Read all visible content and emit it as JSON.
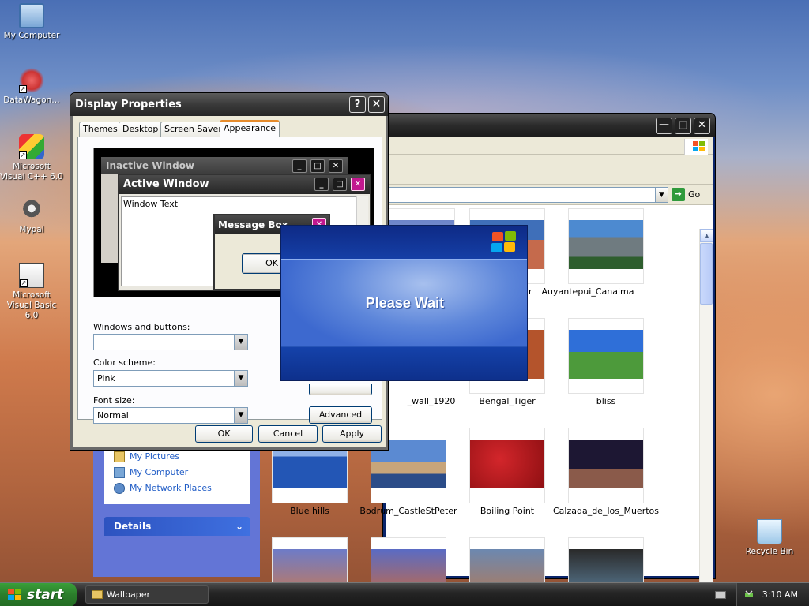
{
  "desktop": {
    "icons": [
      {
        "label": "My Computer",
        "icon": "my-computer-icon"
      },
      {
        "label": "DataWagon…",
        "icon": "datawagon-icon"
      },
      {
        "label": "Microsoft Visual C++ 6.0",
        "icon": "visual-cpp-icon"
      },
      {
        "label": "Mypal",
        "icon": "mypal-icon"
      },
      {
        "label": "Microsoft Visual Basic 6.0",
        "icon": "visual-basic-icon"
      },
      {
        "label": "Recycle Bin",
        "icon": "recycle-bin-icon"
      }
    ]
  },
  "explorer": {
    "go_label": "Go",
    "task_links": [
      "My Pictures",
      "My Computer",
      "My Network Places"
    ],
    "details_label": "Details",
    "thumbnails": [
      {
        "label": "",
        "color": "#6d85c9"
      },
      {
        "label": "",
        "color": "#c56a4c"
      },
      {
        "label": "Auyantepui_Canaima",
        "color": "#5d8cc9"
      },
      {
        "label": "_wall_1920",
        "color": "#33468c"
      },
      {
        "label": "Bengal_Tiger",
        "color": "#b4542c"
      },
      {
        "label": "bliss",
        "color": "#4d9a3b"
      },
      {
        "label": "Blue hills",
        "color": "#2356b5"
      },
      {
        "label": "Bodrum_CastleStPeter",
        "color": "#4a7cc2"
      },
      {
        "label": "Boiling Point",
        "color": "#b01419"
      },
      {
        "label": "Calzada_de_los_Muertos",
        "color": "#2b2140"
      },
      {
        "label": "",
        "color": "#6d7bc8"
      },
      {
        "label": "",
        "color": "#5a6bc4"
      },
      {
        "label": "",
        "color": "#6c88b0"
      },
      {
        "label": "",
        "color": "#2a2a2a"
      }
    ],
    "partial_label": "zabur"
  },
  "dialog": {
    "title": "Display Properties",
    "help_label": "?",
    "tabs": [
      "Themes",
      "Desktop",
      "Screen Saver",
      "Appearance"
    ],
    "active_tab": "Appearance",
    "preview": {
      "inactive_title": "Inactive Window",
      "active_title": "Active Window",
      "window_text": "Window Text",
      "msgbox_title": "Message Box",
      "ok_label": "OK"
    },
    "windows_buttons_label": "Windows and buttons:",
    "windows_buttons_value": "",
    "color_scheme_label": "Color scheme:",
    "color_scheme_value": "Pink",
    "font_size_label": "Font size:",
    "font_size_value": "Normal",
    "advanced_label": "Advanced",
    "ok_label": "OK",
    "cancel_label": "Cancel",
    "apply_label": "Apply"
  },
  "splash": {
    "text": "Please Wait"
  },
  "taskbar": {
    "start_label": "start",
    "task_label": "Wallpaper",
    "clock": "3:10 AM"
  },
  "colors": {
    "accent_pink": "#c2188f",
    "xp_blue": "#1c4ab0",
    "start_green": "#2b7d2b"
  }
}
